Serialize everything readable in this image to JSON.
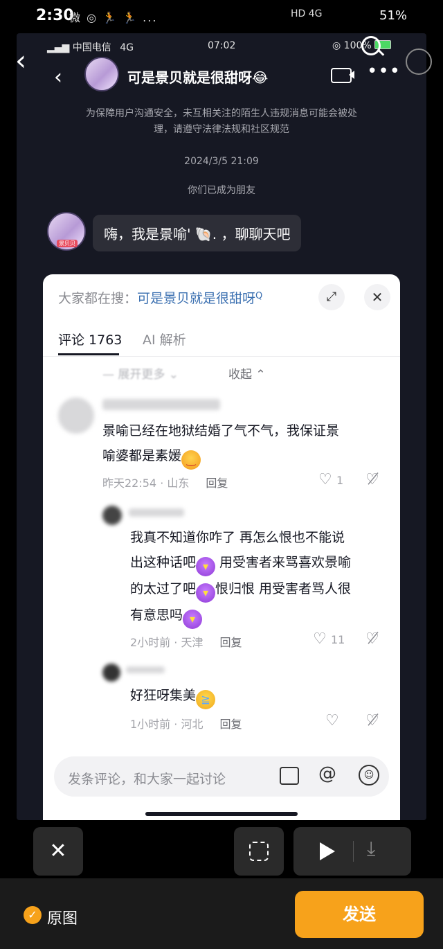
{
  "outer_status": {
    "time": "2:30",
    "notif_icons": "微 ◎ 🏃 🏃 ...",
    "signal": "HD 4G",
    "battery": "51%"
  },
  "inner_status": {
    "carrier": "中国电信",
    "network": "4G",
    "time": "07:02",
    "battery": "100%"
  },
  "chat": {
    "title": "可是景贝就是很甜呀😂",
    "notice": "为保障用户沟通安全，未互相关注的陌生人违规消息可能会被处理，请遵守法律法规和社区规范",
    "date": "2024/3/5 21:09",
    "friends_text": "你们已成为朋友",
    "bubble": "嗨，我是景喻' 🐚.  ，聊聊天吧",
    "avatar_tag": "景贝贝"
  },
  "sheet": {
    "search_prefix": "大家都在搜：",
    "search_term": "可是景贝就是很甜呀",
    "tabs": [
      {
        "label": "评论 1763"
      },
      {
        "label": "AI 解析"
      }
    ],
    "expand_more": "展开更多",
    "collapse": "收起",
    "comments": [
      {
        "text_1": "景喻已经在地狱结婚了气不气，我保证景",
        "text_2": "喻婆都是素媛",
        "time": "昨天22:54 · 山东",
        "reply": "回复",
        "likes": "1"
      },
      {
        "text_1": "我真不知道你咋了 再怎么恨也不能说",
        "text_2": "出这种话吧",
        "text_2b": " 用受害者来骂喜欢景喻",
        "text_3": "的太过了吧",
        "text_3b": "恨归恨 用受害者骂人很",
        "text_4": "有意思吗",
        "time": "2小时前 · 天津",
        "reply": "回复",
        "likes": "11"
      },
      {
        "text_1": "好狂呀集美",
        "time": "1小时前 · 河北",
        "reply": "回复",
        "likes": ""
      }
    ],
    "input_placeholder": "发条评论，和大家一起讨论"
  },
  "footer": {
    "original_label": "原图",
    "send_label": "发送"
  },
  "colors": {
    "accent_orange": "#f7a21b",
    "link_blue": "#3a6fb0"
  }
}
